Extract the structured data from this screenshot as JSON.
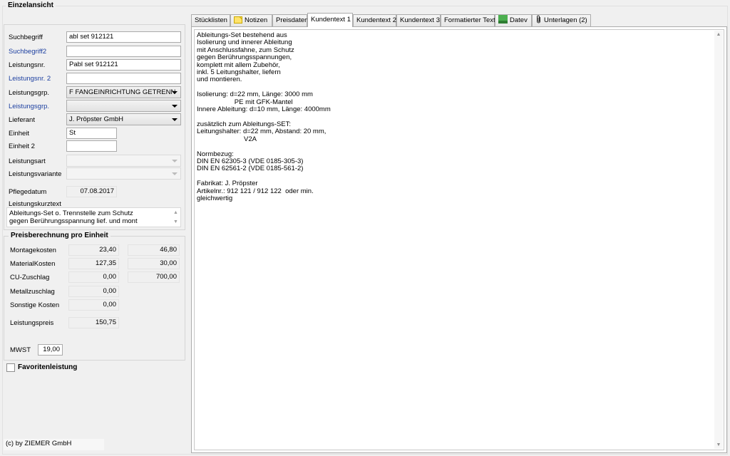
{
  "window": {
    "title": "Einzelansicht"
  },
  "left": {
    "fields": {
      "suchbegriff": {
        "label": "Suchbegriff",
        "value": "abl set 912121"
      },
      "suchbegriff2": {
        "label": "Suchbegriff2",
        "value": ""
      },
      "leistungsnr": {
        "label": "Leistungsnr.",
        "value": "Pabl set 912121"
      },
      "leistungsnr2": {
        "label": "Leistungsnr. 2",
        "value": ""
      },
      "leistungsgrp1": {
        "label": "Leistungsgrp.",
        "value": "F FANGEINRICHTUNG GETRENN"
      },
      "leistungsgrp2": {
        "label": "Leistungsgrp.",
        "value": ""
      },
      "lieferant": {
        "label": "Lieferant",
        "value": "J. Pröpster GmbH"
      },
      "einheit": {
        "label": "Einheit",
        "value": "St"
      },
      "einheit2": {
        "label": "Einheit 2",
        "value": ""
      },
      "leistungsart": {
        "label": "Leistungsart",
        "value": ""
      },
      "leistungsvariante": {
        "label": "Leistungsvariante",
        "value": ""
      },
      "pflegedatum": {
        "label": "Pflegedatum",
        "value": "07.08.2017"
      },
      "kurztext": {
        "label": "Leistungskurztext",
        "value": "Ableitungs-Set o. Trennstelle zum Schutz\ngegen Berührungsspannung lief. und mont"
      }
    },
    "preis": {
      "title": "Preisberechnung pro Einheit",
      "rows": [
        {
          "label": "Montagekosten",
          "v1": "23,40",
          "v2": "46,80"
        },
        {
          "label": "MaterialKosten",
          "v1": "127,35",
          "v2": "30,00"
        },
        {
          "label": "CU-Zuschlag",
          "v1": "0,00",
          "v2": "700,00"
        },
        {
          "label": "Metallzuschlag",
          "v1": "0,00",
          "v2": null
        },
        {
          "label": "Sonstige Kosten",
          "v1": "0,00",
          "v2": null
        }
      ],
      "leistungspreis_label": "Leistungspreis",
      "leistungspreis": "150,75",
      "mwst_label": "MWST",
      "mwst": "19,00"
    },
    "favorit_label": "Favoritenleistung",
    "favorit_checked": false,
    "copyright": "(c) by ZIEMER GmbH"
  },
  "tabs": [
    {
      "label": "Stücklisten",
      "icon": null
    },
    {
      "label": "Notizen",
      "icon": "note-icon"
    },
    {
      "label": "Preisdaten",
      "icon": null
    },
    {
      "label": "Kundentext 1",
      "icon": null,
      "active": true
    },
    {
      "label": "Kundentext 2",
      "icon": null
    },
    {
      "label": "Kundentext 3",
      "icon": null
    },
    {
      "label": "Formatierter Text",
      "icon": null
    },
    {
      "label": "Datev",
      "icon": "datev-icon"
    },
    {
      "label": "Unterlagen (2)",
      "icon": "paperclip-icon"
    }
  ],
  "kundentext": "Ableitungs-Set bestehend aus\nIsolierung und innerer Ableitung\nmit Anschlussfahne, zum Schutz\ngegen Berührungsspannungen,\nkomplett mit allem Zubehör,\ninkl. 5 Leitungshalter, liefern\nund montieren.\n\nIsolierung: d=22 mm, Länge: 3000 mm\n                    PE mit GFK-Mantel\nInnere Ableitung: d=10 mm, Länge: 4000mm\n\nzusätzlich zum Ableitungs-SET:\nLeitungshalter: d=22 mm, Abstand: 20 mm,\n                         V2A\n\nNormbezug:\nDIN EN 62305-3 (VDE 0185-305-3)\nDIN EN 62561-2 (VDE 0185-561-2)\n\nFabrikat: J. Pröpster\nArtikelnr.: 912 121 / 912 122  oder min.\ngleichwertig",
  "colors": {
    "label_blue": "#1c3fa0",
    "datev_green": "#4caf50",
    "note_yellow": "#ffe36b"
  }
}
